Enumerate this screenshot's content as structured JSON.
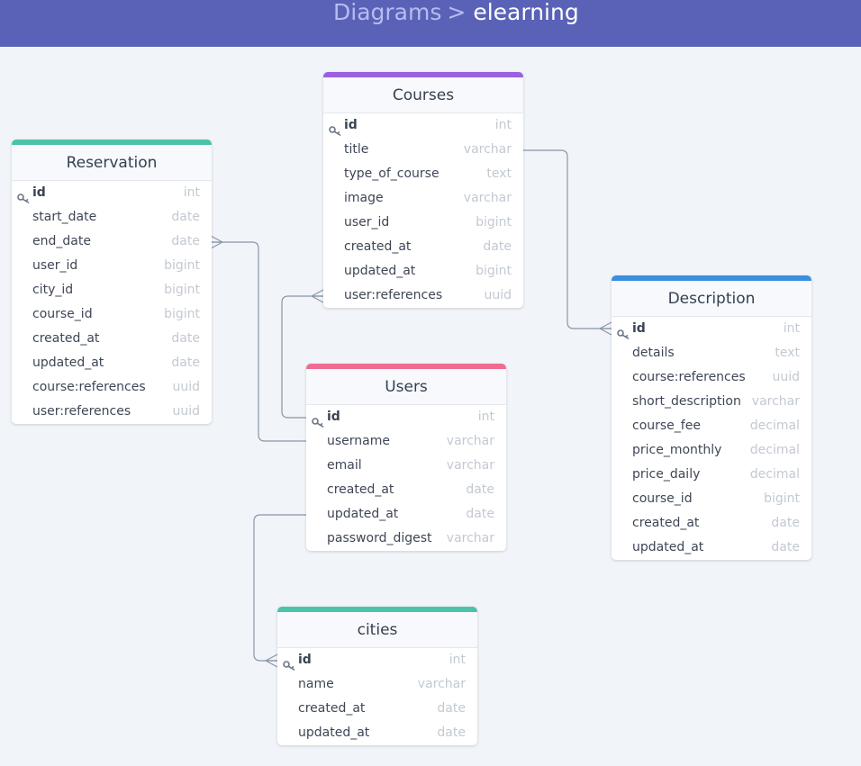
{
  "header": {
    "root": "Diagrams",
    "separator": ">",
    "current": "elearning"
  },
  "colors": {
    "header_bg": "#5a62b8",
    "courses_accent": "#9b5fe0",
    "reservation_accent": "#4cc3a8",
    "users_accent": "#f06b92",
    "description_accent": "#3b8fe0",
    "cities_accent": "#4cc3a8"
  },
  "tables": {
    "courses": {
      "name": "Courses",
      "fields": [
        {
          "name": "id",
          "type": "int",
          "pk": true
        },
        {
          "name": "title",
          "type": "varchar"
        },
        {
          "name": "type_of_course",
          "type": "text"
        },
        {
          "name": "image",
          "type": "varchar"
        },
        {
          "name": "user_id",
          "type": "bigint"
        },
        {
          "name": "created_at",
          "type": "date"
        },
        {
          "name": "updated_at",
          "type": "bigint"
        },
        {
          "name": "user:references",
          "type": "uuid"
        }
      ]
    },
    "reservation": {
      "name": "Reservation",
      "fields": [
        {
          "name": "id",
          "type": "int",
          "pk": true
        },
        {
          "name": "start_date",
          "type": "date"
        },
        {
          "name": "end_date",
          "type": "date"
        },
        {
          "name": "user_id",
          "type": "bigint"
        },
        {
          "name": "city_id",
          "type": "bigint"
        },
        {
          "name": "course_id",
          "type": "bigint"
        },
        {
          "name": "created_at",
          "type": "date"
        },
        {
          "name": "updated_at",
          "type": "date"
        },
        {
          "name": "course:references",
          "type": "uuid"
        },
        {
          "name": "user:references",
          "type": "uuid"
        }
      ]
    },
    "users": {
      "name": "Users",
      "fields": [
        {
          "name": "id",
          "type": "int",
          "pk": true
        },
        {
          "name": "username",
          "type": "varchar"
        },
        {
          "name": "email",
          "type": "varchar"
        },
        {
          "name": "created_at",
          "type": "date"
        },
        {
          "name": "updated_at",
          "type": "date"
        },
        {
          "name": "password_digest",
          "type": "varchar"
        }
      ]
    },
    "description": {
      "name": "Description",
      "fields": [
        {
          "name": "id",
          "type": "int",
          "pk": true
        },
        {
          "name": "details",
          "type": "text"
        },
        {
          "name": "course:references",
          "type": "uuid"
        },
        {
          "name": "short_description",
          "type": "varchar"
        },
        {
          "name": "course_fee",
          "type": "decimal"
        },
        {
          "name": "price_monthly",
          "type": "decimal"
        },
        {
          "name": "price_daily",
          "type": "decimal"
        },
        {
          "name": "course_id",
          "type": "bigint"
        },
        {
          "name": "created_at",
          "type": "date"
        },
        {
          "name": "updated_at",
          "type": "date"
        }
      ]
    },
    "cities": {
      "name": "cities",
      "fields": [
        {
          "name": "id",
          "type": "int",
          "pk": true
        },
        {
          "name": "name",
          "type": "varchar"
        },
        {
          "name": "created_at",
          "type": "date"
        },
        {
          "name": "updated_at",
          "type": "date"
        }
      ]
    }
  }
}
